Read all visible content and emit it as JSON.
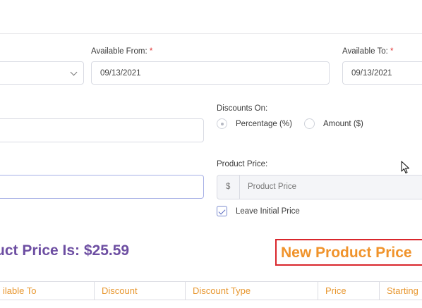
{
  "form": {
    "available_from": {
      "label": "Available From:",
      "required_mark": "*",
      "value": "09/13/2021"
    },
    "available_to": {
      "label": "Available To:",
      "required_mark": "*",
      "value": "09/13/2021"
    },
    "discounts_on": {
      "label": "Discounts On:",
      "options": [
        {
          "label": "Percentage (%)",
          "selected": true
        },
        {
          "label": "Amount ($)",
          "selected": false
        }
      ]
    },
    "product_price": {
      "label": "Product Price:",
      "prefix": "$",
      "placeholder": "Product Price"
    },
    "leave_initial_price": {
      "label": "Leave Initial Price",
      "checked": true
    }
  },
  "summary": {
    "current_price_text": "uct Price Is: $25.59",
    "new_price_text": "New Product Price"
  },
  "table": {
    "columns": [
      "ilable To",
      "Discount",
      "Discount Type",
      "Price",
      "Starting"
    ]
  },
  "colors": {
    "purple_heading": "#6d4ea2",
    "orange_accent": "#f0932b",
    "red_highlight": "#d9262c"
  }
}
